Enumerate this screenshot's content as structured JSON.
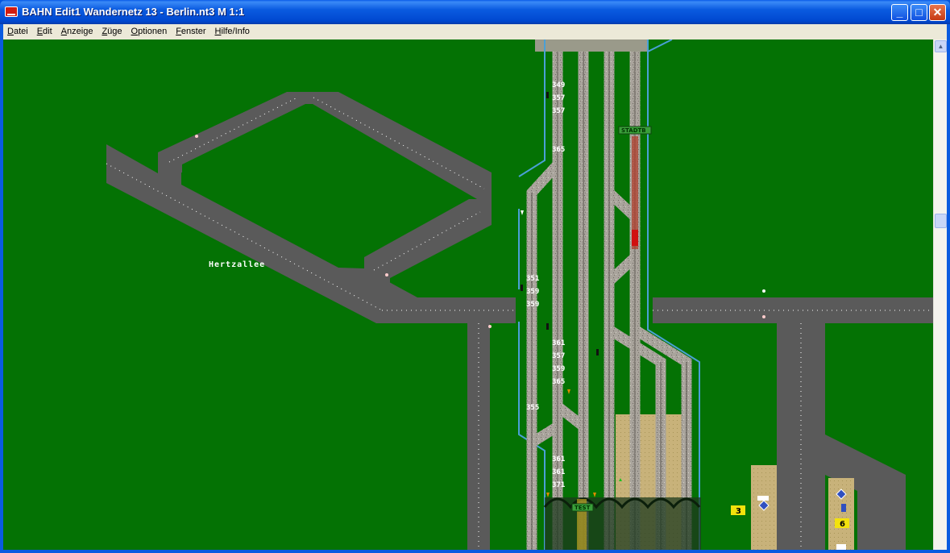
{
  "window": {
    "title": "BAHN Edit1 Wandernetz 13 - Berlin.nt3 M 1:1"
  },
  "menu": [
    "Datei",
    "Edit",
    "Anzeige",
    "Züge",
    "Optionen",
    "Fenster",
    "Hilfe/Info"
  ],
  "map": {
    "street_name": "Hertzallee",
    "stations": [
      "STADTB",
      "TEST"
    ],
    "track_numbers": [
      "349",
      "357",
      "357",
      "365",
      "351",
      "359",
      "359",
      "361",
      "357",
      "359",
      "365",
      "355",
      "361",
      "361",
      "371"
    ],
    "platforms": [
      "3",
      "6"
    ]
  },
  "colors": {
    "ground": "#047204",
    "road": "#5a5a5a",
    "track": "#a9a49c",
    "water_edge": "#4aa0d6",
    "platform": "#c8b27a"
  }
}
